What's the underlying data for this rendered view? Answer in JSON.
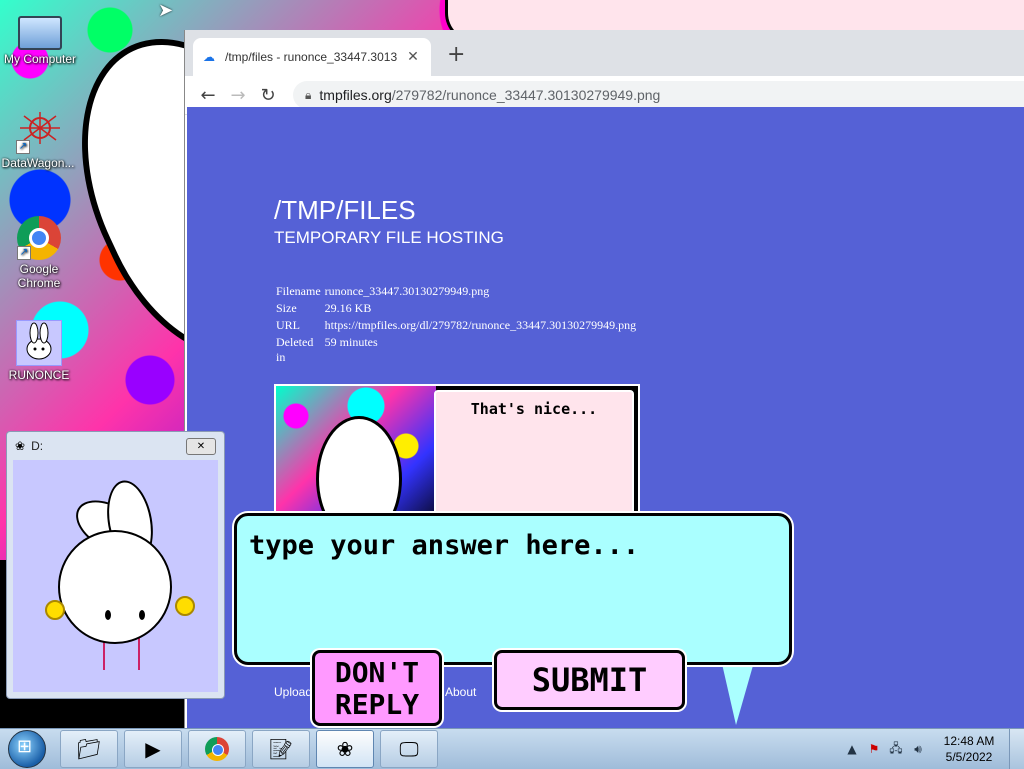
{
  "desktop": {
    "icons": [
      {
        "label": "My Computer",
        "icon": "computer-icon"
      },
      {
        "label": "DataWagon...",
        "icon": "spider-icon"
      },
      {
        "label": "Google Chrome",
        "icon": "chrome-icon"
      },
      {
        "label": "RUNONCE",
        "icon": "bunny-icon"
      }
    ]
  },
  "browser": {
    "tab_title": "/tmp/files - runonce_33447.3013",
    "url_host": "tmpfiles.org",
    "url_path": "/279782/runonce_33447.30130279949.png",
    "page": {
      "title": "/TMP/FILES",
      "subtitle": "TEMPORARY FILE HOSTING",
      "info": [
        {
          "key": "Filename",
          "value": "runonce_33447.30130279949.png"
        },
        {
          "key": "Size",
          "value": "29.16 KB"
        },
        {
          "key": "URL",
          "value": "https://tmpfiles.org/dl/279782/runonce_33447.30130279949.png"
        },
        {
          "key": "Deleted in",
          "value": "59 minutes"
        }
      ],
      "preview_text": "That's nice...",
      "footer_upload": "Upload",
      "footer_about": "About"
    }
  },
  "dwindow": {
    "title": "D:"
  },
  "dialog": {
    "placeholder": "type your answer here...",
    "dont_reply": "DON'T REPLY",
    "submit": "SUBMIT"
  },
  "taskbar": {
    "apps": [
      "explorer-icon",
      "media-player-icon",
      "chrome-icon",
      "notepad-icon",
      "bunny-icon",
      "monitor-icon"
    ],
    "time": "12:48 AM",
    "date": "5/5/2022"
  },
  "colors": {
    "page_bg": "#5561d6",
    "bubble": "#aaffff",
    "dont_btn": "#ff99ff",
    "submit_btn": "#ffccff"
  }
}
